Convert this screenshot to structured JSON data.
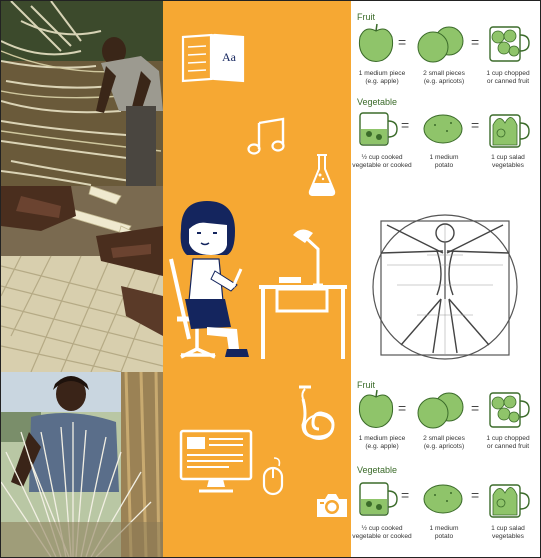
{
  "servings_top": {
    "fruit_title": "Fruit",
    "fruit_captions": [
      [
        "1 medium piece",
        "(e.g. apple)"
      ],
      [
        "2 small pieces",
        "(e.g. apricots)"
      ],
      [
        "1 cup chopped",
        "or canned fruit"
      ]
    ],
    "veg_title": "Vegetable",
    "veg_captions": [
      [
        "½ cup cooked",
        "vegetable or cooked"
      ],
      [
        "1 medium",
        "potato"
      ],
      [
        "1 cup salad",
        "vegetables"
      ]
    ],
    "equals": "="
  },
  "servings_bottom": {
    "fruit_title": "Fruit",
    "fruit_captions": [
      [
        "1 medium piece",
        "(e.g. apple)"
      ],
      [
        "2 small pieces",
        "(e.g. apricots)"
      ],
      [
        "1 cup chopped",
        "or canned fruit"
      ]
    ],
    "veg_title": "Vegetable",
    "veg_captions": [
      [
        "½ cup cooked",
        "vegetable or cooked"
      ],
      [
        "1 medium",
        "potato"
      ],
      [
        "1 cup salad",
        "vegetables"
      ]
    ],
    "equals": "="
  },
  "book_icon_text": "Aa",
  "colors": {
    "orange": "#f6a833",
    "navy": "#14255e",
    "green": "#8fc46a",
    "dark_green": "#3b6b2a"
  },
  "icons": [
    "book-icon",
    "music-note-icon",
    "flask-icon",
    "desk-lamp-icon",
    "horn-icon",
    "computer-monitor-icon",
    "mouse-icon",
    "camera-icon"
  ]
}
